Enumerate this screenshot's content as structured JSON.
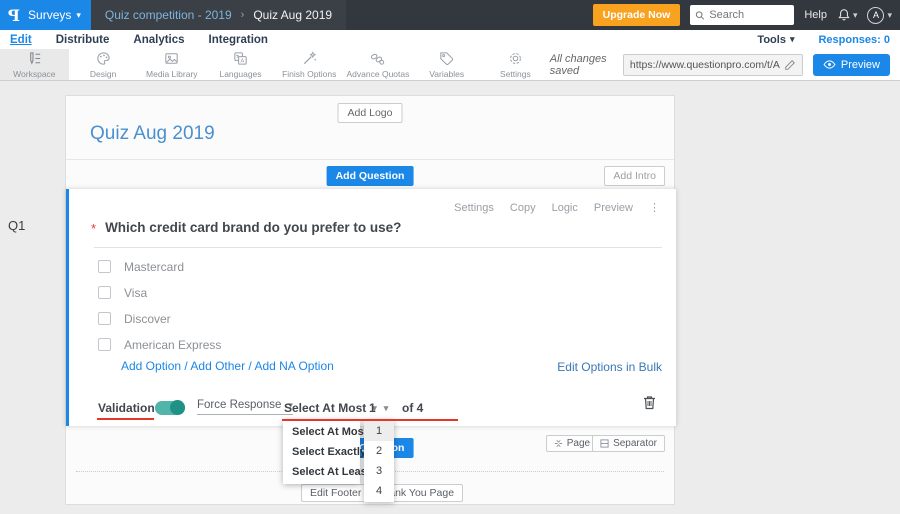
{
  "topbar": {
    "logo": "P",
    "surveys_label": "Surveys",
    "breadcrumb": {
      "parent": "Quiz competition - 2019",
      "separator": "›",
      "current": "Quiz Aug 2019"
    },
    "upgrade_label": "Upgrade Now",
    "search_placeholder": "Search",
    "help_label": "Help",
    "avatar_letter": "A"
  },
  "nav": {
    "items": [
      "Edit",
      "Distribute",
      "Analytics",
      "Integration"
    ],
    "tools_label": "Tools",
    "responses_label": "Responses: 0"
  },
  "toolbar": {
    "items": [
      {
        "label": "Workspace",
        "icon": "workspace-icon",
        "active": true
      },
      {
        "label": "Design",
        "icon": "design-icon"
      },
      {
        "label": "Media Library",
        "icon": "media-library-icon"
      },
      {
        "label": "Languages",
        "icon": "languages-icon"
      },
      {
        "label": "Finish Options",
        "icon": "finish-options-icon"
      },
      {
        "label": "Advance Quotas",
        "icon": "advance-quotas-icon"
      },
      {
        "label": "Variables",
        "icon": "variables-icon"
      },
      {
        "label": "Settings",
        "icon": "settings-icon"
      }
    ],
    "saved_label": "All changes saved",
    "url_value": "https://www.questionpro.com/t/APNrFZ",
    "preview_label": "Preview"
  },
  "survey": {
    "add_logo_label": "Add Logo",
    "title": "Quiz Aug 2019",
    "add_question_label": "Add Question",
    "add_intro_label": "Add Intro",
    "question": {
      "id_label": "Q1",
      "required_marker": "*",
      "text": "Which credit card brand do you prefer to use?",
      "menu": [
        "Settings",
        "Copy",
        "Logic",
        "Preview"
      ],
      "options": [
        "Mastercard",
        "Visa",
        "Discover",
        "American Express"
      ],
      "add_links": [
        "Add Option",
        "Add Other",
        "Add NA Option"
      ],
      "link_separator": " / ",
      "bulk_edit_label": "Edit Options in Bulk",
      "validation": {
        "label": "Validation",
        "toggle_on": true,
        "force_response_label": "Force Response",
        "rule_selected": "Select At Most",
        "count_selected": "1",
        "of_label": "of 4"
      }
    },
    "rule_dropdown_options": [
      "Select At Most",
      "Select Exactly",
      "Select At Least"
    ],
    "count_dropdown_options": [
      "1",
      "2",
      "3",
      "4"
    ],
    "add_question2_label": "Add Question",
    "page_break_label": "Page Break",
    "separator_label": "Separator",
    "edit_footer_label": "Edit Footer",
    "thank_you_label": "Thank You Page"
  },
  "colors": {
    "accent_blue": "#1b87e6",
    "upgrade_orange": "#f9a21f",
    "toggle_teal": "#52b5aa",
    "annotation_red": "#e8352c",
    "title_blue": "#4a90cf",
    "topbar_dark": "#33383e"
  }
}
